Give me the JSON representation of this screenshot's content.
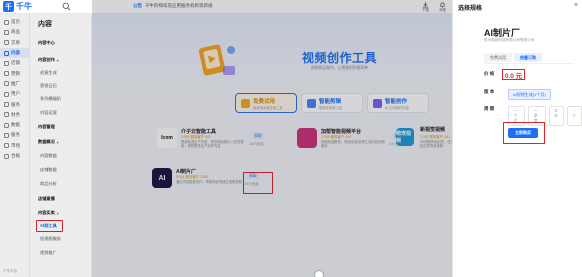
{
  "app": {
    "logo_text": "千牛",
    "logo_mark": "千"
  },
  "topbar": {
    "notice_tag": "公告",
    "notice_text": "千牛阶梯扣及应用服务机构等新规",
    "items": [
      {
        "label": "下载"
      },
      {
        "label": "消息"
      }
    ]
  },
  "rail": {
    "items": [
      {
        "label": "首页"
      },
      {
        "label": "商品"
      },
      {
        "label": "交易"
      },
      {
        "label": "内容",
        "active": true
      },
      {
        "label": "店铺"
      },
      {
        "label": "营销"
      },
      {
        "label": "推广"
      },
      {
        "label": "用户"
      },
      {
        "label": "服务"
      },
      {
        "label": "财务"
      },
      {
        "label": "数据"
      },
      {
        "label": "服务"
      },
      {
        "label": "市场"
      },
      {
        "label": "合规"
      }
    ],
    "footer": "千牛平台"
  },
  "sidebar": {
    "title": "内容",
    "rows": [
      {
        "label": "内容中心",
        "type": "group"
      },
      {
        "label": "内容创作",
        "type": "group",
        "caret": "▾"
      },
      {
        "label": "创意生成",
        "type": "sub"
      },
      {
        "label": "营销日历",
        "type": "sub"
      },
      {
        "label": "系列横幅机",
        "type": "sub"
      },
      {
        "label": "内容运营",
        "type": "sub"
      },
      {
        "label": "内容管理",
        "type": "group"
      },
      {
        "label": "数据概况",
        "type": "group",
        "caret": "▾"
      },
      {
        "label": "内容数据",
        "type": "sub"
      },
      {
        "label": "店铺数据",
        "type": "sub"
      },
      {
        "label": "商品分析",
        "type": "sub"
      },
      {
        "label": "店铺直播",
        "type": "group"
      },
      {
        "label": "内容买卖",
        "type": "group",
        "caret": "▾"
      },
      {
        "label": "AI制工具",
        "type": "sub",
        "active": true
      },
      {
        "label": "短视频服务",
        "type": "sub"
      },
      {
        "label": "视频推广",
        "type": "sub"
      }
    ]
  },
  "hero": {
    "title": "视频创作工具",
    "subtitle": "视频商品制作，让视频创作更简单"
  },
  "pills": [
    {
      "title": "免费试用",
      "sub": "免费用大量应用工具",
      "active": true,
      "color": "#f5a623"
    },
    {
      "title": "智能剪辑",
      "sub": "智能化剪辑工具",
      "color": "#4a86f7"
    },
    {
      "title": "智能创作",
      "sub": "AI 生成素材内容",
      "color": "#7b61ff"
    }
  ],
  "cards": [
    {
      "name": "介子云智能工具",
      "score": "3.0分 服务客户 402",
      "desc": "视频精选生产内容，提供商品展示入驻的视频，携助更多生产创作内容",
      "button": "获取",
      "free": "100元免费",
      "logo_text": "Icom",
      "logo_color": "#ffffff"
    },
    {
      "name": "加帮智能视频平台",
      "score": "3.0分 服务客户 464",
      "desc": "视频精选服务，商品信息/剪辑工具内容剪辑服务",
      "button": "获取",
      "free": "100元免费",
      "logo_color": "#c9327a"
    },
    {
      "name": "新视觉视频",
      "score": "3.0分 服务客户 391",
      "desc": "3D视频商品创意，在广告创意商品视频",
      "button": "获取",
      "free": "",
      "logo_text": "萌宠视频",
      "logo_color": "#1b9ad6"
    },
    {
      "name": "AI制片厂",
      "score": "5.0分 服务客户 2282",
      "desc": "通过内容智能创作，帮助商家快速生成短视频",
      "button": "获取",
      "free": "100元免费",
      "logo_text": "AI",
      "logo_color": "#1a1440"
    }
  ],
  "drawer": {
    "title": "选择规格",
    "close": "×",
    "product_name": "AI制片厂",
    "company": "杭州象数科技有限公司有限公司",
    "tabs": [
      {
        "label": "免费试用"
      },
      {
        "label": "按量订购",
        "active": true
      }
    ],
    "price_label": "价 格",
    "price_value": "0.0 元",
    "version_label": "版 本",
    "version_value": "AI视频生成(1个月)",
    "period_label": "周 期",
    "periods": [
      {
        "label": "一个月"
      },
      {
        "label": "一季度"
      },
      {
        "label": "半年"
      },
      {
        "label": "一年"
      }
    ],
    "buy_button": "立即购买"
  }
}
